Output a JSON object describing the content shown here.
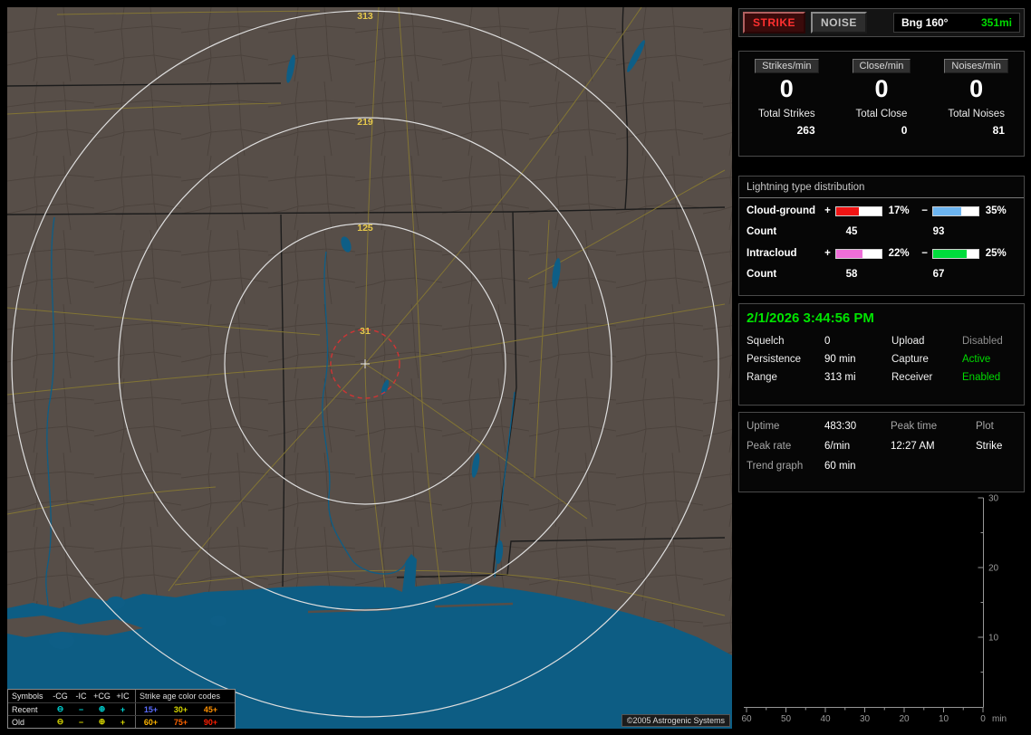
{
  "app": {
    "copyright": "©2005 Astrogenic Systems"
  },
  "controls": {
    "strike": "STRIKE",
    "noise": "NOISE",
    "bearing_label": "Bng 160°",
    "bearing_range": "351mi"
  },
  "stats": {
    "columns": [
      {
        "chip": "Strikes/min",
        "rate": "0",
        "total_label": "Total Strikes",
        "total_value": "263"
      },
      {
        "chip": "Close/min",
        "rate": "0",
        "total_label": "Total Close",
        "total_value": "0"
      },
      {
        "chip": "Noises/min",
        "rate": "0",
        "total_label": "Total Noises",
        "total_value": "81"
      }
    ]
  },
  "distribution": {
    "title": "Lightning type distribution",
    "rows": [
      {
        "name": "Cloud-ground",
        "plus_sign": "+",
        "minus_sign": "−",
        "plus_pct": "17%",
        "minus_pct": "35%",
        "plus_fill": "50%",
        "minus_fill": "62%",
        "plus_color": "#f01414",
        "minus_color": "#6cb4f0",
        "count_label": "Count",
        "plus_count": "45",
        "minus_count": "93"
      },
      {
        "name": "Intracloud",
        "plus_sign": "+",
        "minus_sign": "−",
        "plus_pct": "22%",
        "minus_pct": "25%",
        "plus_fill": "58%",
        "minus_fill": "74%",
        "plus_color": "#ee6ed8",
        "minus_color": "#00dc3c",
        "count_label": "Count",
        "plus_count": "58",
        "minus_count": "67"
      }
    ]
  },
  "status": {
    "datetime": "2/1/2026 3:44:56 PM",
    "left": [
      {
        "label": "Squelch",
        "value": "0",
        "color": "#ffffff"
      },
      {
        "label": "Persistence",
        "value": "90 min",
        "color": "#ffffff"
      },
      {
        "label": "Range",
        "value": "313 mi",
        "color": "#ffffff"
      }
    ],
    "right": [
      {
        "label": "Upload",
        "value": "Disabled",
        "color": "#8f8f8f"
      },
      {
        "label": "Capture",
        "value": "Active",
        "color": "#00dc00"
      },
      {
        "label": "Receiver",
        "value": "Enabled",
        "color": "#00dc00"
      }
    ]
  },
  "session": {
    "uptime_label": "Uptime",
    "uptime_value": "483:30",
    "peak_time_label": "Peak time",
    "peak_time_value": "12:27 AM",
    "plot_label": "Plot",
    "plot_value": "Strike",
    "peak_rate_label": "Peak rate",
    "peak_rate_value": "6/min",
    "trend_label": "Trend graph",
    "trend_value": "60 min"
  },
  "trend_graph": {
    "y_ticks": [
      "30",
      "20",
      "10"
    ],
    "x_ticks": [
      "60",
      "50",
      "40",
      "30",
      "20",
      "10",
      "0"
    ],
    "x_unit": "min"
  },
  "map": {
    "range_labels": [
      "313",
      "219",
      "125",
      "31"
    ],
    "legend": {
      "symbols_header": "Symbols",
      "type_headers": [
        "-CG",
        "-IC",
        "+CG",
        "+IC"
      ],
      "age_header": "Strike age color codes",
      "rows": [
        {
          "label": "Recent",
          "symbol_color": "#00d8d8",
          "glyphs": [
            "⊖",
            "−",
            "⊕",
            "+"
          ],
          "ages": [
            {
              "text": "15+",
              "color": "#5a6cff"
            },
            {
              "text": "30+",
              "color": "#d8d800"
            },
            {
              "text": "45+",
              "color": "#ff9000"
            }
          ]
        },
        {
          "label": "Old",
          "symbol_color": "#d8d800",
          "glyphs": [
            "⊖",
            "−",
            "⊕",
            "+"
          ],
          "ages": [
            {
              "text": "60+",
              "color": "#ffb400"
            },
            {
              "text": "75+",
              "color": "#ff6400"
            },
            {
              "text": "90+",
              "color": "#ff1e00"
            }
          ]
        }
      ]
    }
  }
}
